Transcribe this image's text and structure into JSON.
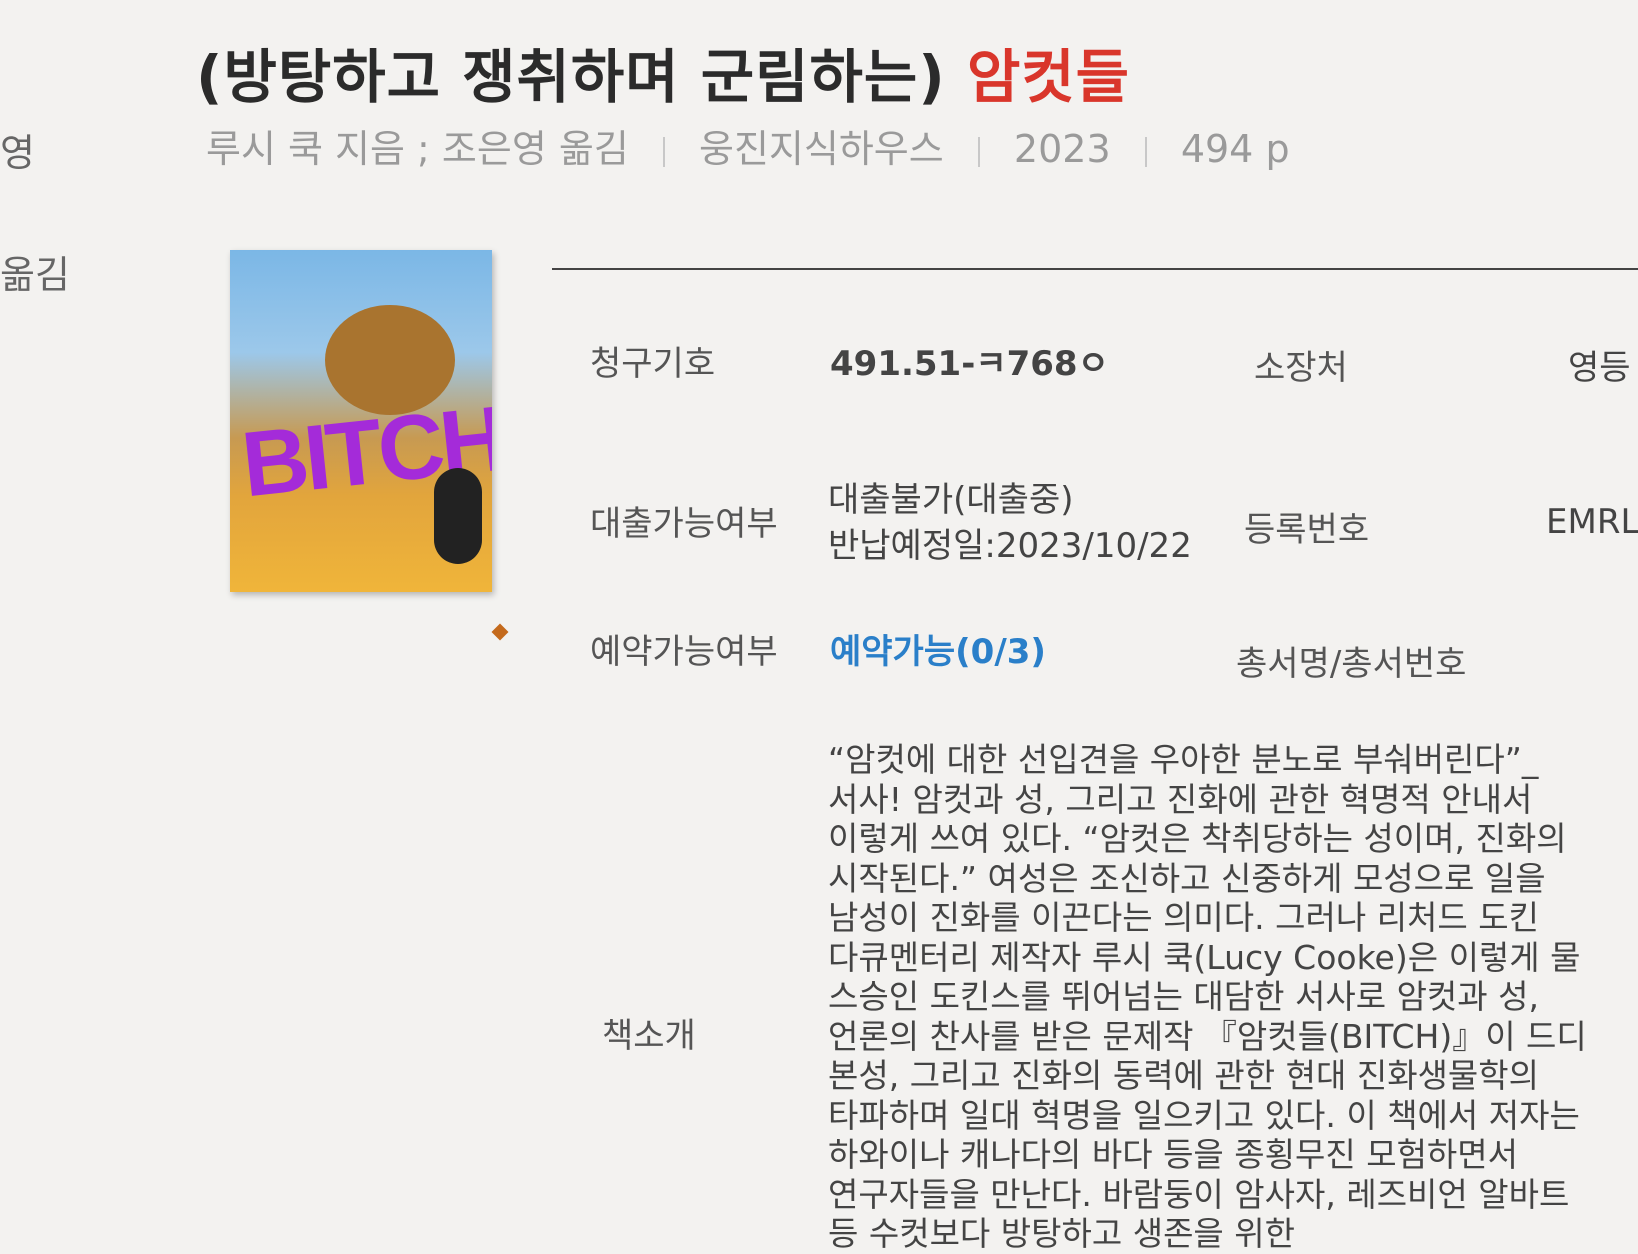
{
  "title": {
    "prefix": "(방탕하고 쟁취하며 군림하는)",
    "highlight": "암컷들"
  },
  "left_fragments": [
    "영",
    "옮김"
  ],
  "meta": {
    "author": "루시 쿡 지음 ; 조은영 옮김",
    "publisher": "웅진지식하우스",
    "year": "2023",
    "pages": "494 p"
  },
  "cover": {
    "text": "BITCH"
  },
  "details": {
    "call_number_label": "청구기호",
    "call_number": "491.51-ㅋ768ㅇ",
    "location_label": "소장처",
    "location": "영등",
    "loan_label": "대출가능여부",
    "loan_status": "대출불가(대출중)",
    "loan_due": "반납예정일:2023/10/22",
    "reg_label": "등록번호",
    "reg_number": "EMRL",
    "reserve_label": "예약가능여부",
    "reserve_status": "예약가능(0/3)",
    "series_label": "총서명/총서번호",
    "intro_label": "책소개"
  },
  "intro_lines": [
    "“암컷에 대한 선입견을 우아한 분노로 부숴버린다”_",
    "서사! 암컷과 성, 그리고 진화에 관한 혁명적 안내서",
    "이렇게 쓰여 있다. “암컷은 착취당하는 성이며, 진화의",
    "시작된다.” 여성은 조신하고 신중하게 모성으로 일을",
    "남성이 진화를 이끈다는 의미다. 그러나 리처드 도킨",
    "다큐멘터리 제작자 루시 쿡(Lucy Cooke)은 이렇게 물",
    "스승인 도킨스를 뛰어넘는 대담한 서사로 암컷과 성,",
    "언론의 찬사를 받은 문제작 『암컷들(BITCH)』이 드디",
    "본성, 그리고 진화의 동력에 관한 현대 진화생물학의",
    "타파하며 일대 혁명을 일으키고 있다. 이 책에서 저자는",
    "하와이나 캐나다의 바다 등을 종횡무진 모험하면서",
    "연구자들을 만난다. 바람둥이 암사자, 레즈비언 알바트",
    "등 수컷보다 방탕하고 생존을 위한"
  ]
}
